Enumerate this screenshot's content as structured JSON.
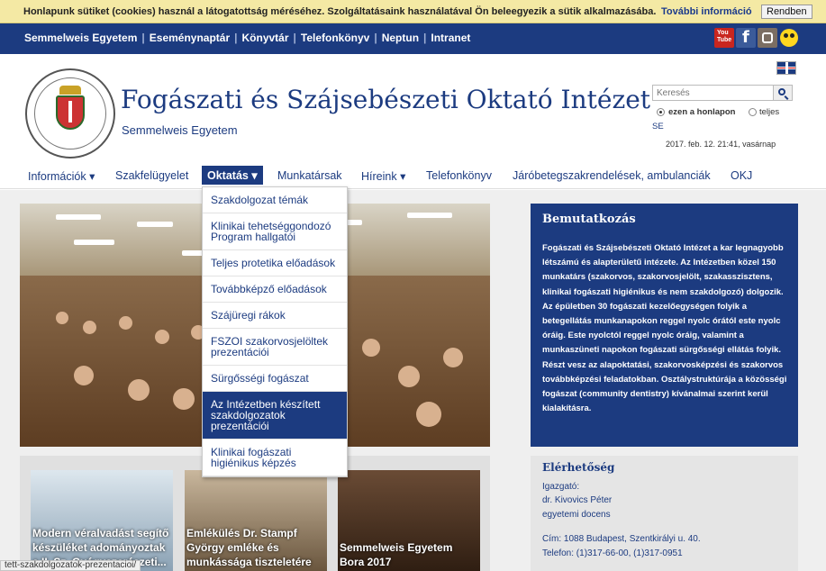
{
  "cookie": {
    "message": "Honlapunk sütiket (cookies) használ a látogatottság méréséhez. Szolgáltatásaink használatával Ön beleegyezik a sütik alkalmazásába.",
    "more_link": "További információ",
    "button": "Rendben"
  },
  "topnav": {
    "items": [
      "Semmelweis Egyetem",
      "Eseménynaptár",
      "Könyvtár",
      "Telefonkönyv",
      "Neptun",
      "Intranet"
    ]
  },
  "header": {
    "title": "Fogászati és Szájsebészeti Oktató Intézet",
    "subtitle": "Semmelweis Egyetem",
    "search_placeholder": "Keresés",
    "radio_this_page": "ezen a honlapon",
    "radio_full": "teljes",
    "se_label": "SE",
    "datetime": "2017. feb. 12. 21:41, vasárnap"
  },
  "menu": {
    "items": [
      "Információk ▾",
      "Szakfelügyelet",
      "Oktatás ▾",
      "Munkatársak",
      "Híreink ▾",
      "Telefonkönyv",
      "Járóbetegszakrendelések, ambulanciák",
      "OKJ"
    ]
  },
  "dropdown": {
    "items": [
      "Szakdolgozat témák",
      "Klinikai tehetséggondozó Program hallgatói",
      "Teljes protetika előadások",
      "Továbbképző előadások",
      "Szájüregi rákok",
      "FSZOI szakorvosjelöltek prezentációi",
      "Sürgősségi fogászat",
      "Az Intézetben készített szakdolgozatok prezentációi",
      "Klinikai fogászati higiénikus képzés"
    ]
  },
  "news": {
    "cards": [
      "Modern véralvadást segítő készüléket adományoztak a II. Sz. Gyógyszerészeti...",
      "Emlékülés Dr. Stampf György emléke és munkássága tiszteletére",
      "Semmelweis Egyetem Bora 2017"
    ]
  },
  "intro": {
    "heading": "Bemutatkozás",
    "text": "Fogászati és Szájsebészeti Oktató Intézet a kar legnagyobb létszámú és alapterületű intézete. Az Intézetben közel 150 munkatárs (szakorvos, szakorvosjelölt, szakasszisztens, klinikai fogászati higiénikus és nem szakdolgozó) dolgozik. Az épületben 30 fogászati kezelőegységen folyik a betegellátás munkanapokon reggel nyolc órától este nyolc óráig. Este nyolctól reggel nyolc óráig, valamint a munkaszüneti napokon fogászati sürgősségi ellátás folyik. Részt vesz az alapoktatási, szakorvosképzési és szakorvos továbbképzési feladatokban. Osztálystruktúrája a közösségi fogászat (community dentistry) kívánalmai szerint kerül kialakításra."
  },
  "contact": {
    "heading": "Elérhetőség",
    "director_label": "Igazgató:",
    "director_name": "dr. Kivovics Péter",
    "director_title": "egyetemi docens",
    "address": "Cím: 1088 Budapest, Szentkirályi u. 40.",
    "phone": "Telefon: (1)317-66-00, (1)317-0951"
  },
  "status_url": "tett-szakdolgozatok-prezentacioi/",
  "colors": {
    "brand": "#1c3b80",
    "cookie_bg": "#f4e9a4"
  },
  "icons": [
    "youtube-icon",
    "facebook-icon",
    "instagram-icon",
    "accessibility-icon",
    "uk-flag-icon",
    "search-icon"
  ]
}
